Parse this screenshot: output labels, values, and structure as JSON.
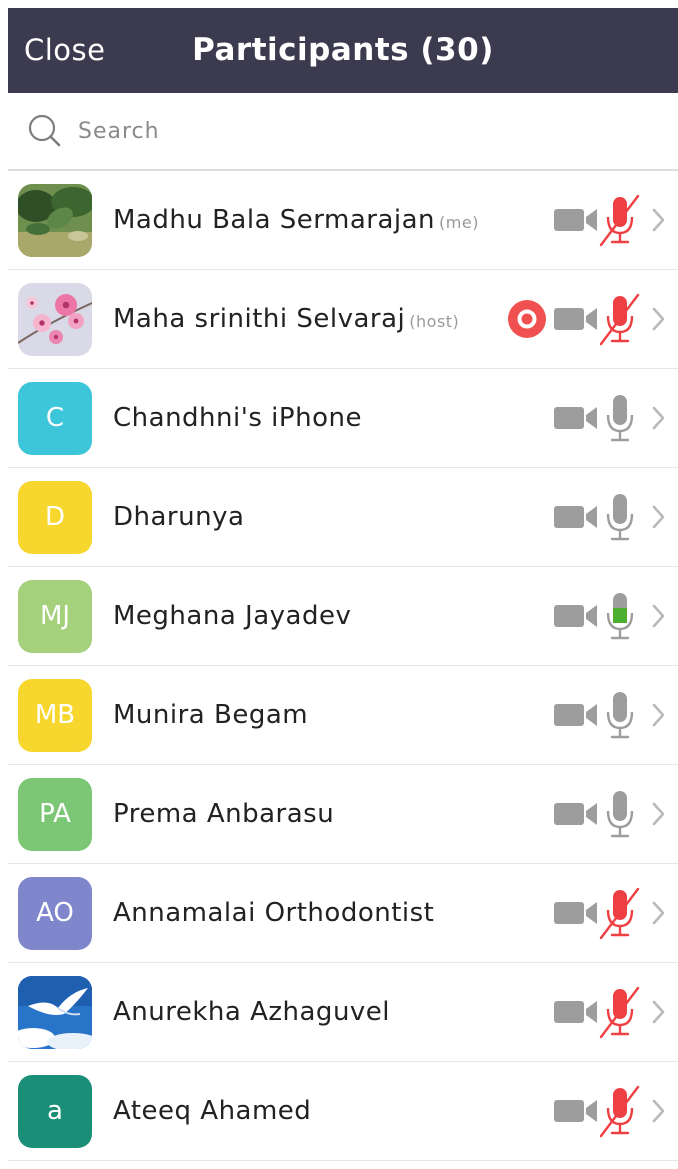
{
  "header": {
    "close_label": "Close",
    "title": "Participants (30)"
  },
  "search": {
    "placeholder": "Search",
    "icon": "search-icon"
  },
  "participants": [
    {
      "name": "Madhu Bala Sermarajan",
      "tag": "(me)",
      "avatar": "photo-leaves",
      "video": "off",
      "mic": "muted",
      "recording": false
    },
    {
      "name": "Maha srinithi Selvaraj",
      "tag": "(host)",
      "avatar": "photo-flowers",
      "video": "off",
      "mic": "muted",
      "recording": true
    },
    {
      "name": "Chandhni's iPhone",
      "tag": "",
      "avatar_initials": "C",
      "avatar_color": "#3dc6d9",
      "video": "off",
      "mic": "unmuted"
    },
    {
      "name": "Dharunya",
      "tag": "",
      "avatar_initials": "D",
      "avatar_color": "#f7d62e",
      "video": "off",
      "mic": "unmuted"
    },
    {
      "name": "Meghana Jayadev",
      "tag": "",
      "avatar_initials": "MJ",
      "avatar_color": "#a5d07c",
      "video": "off",
      "mic": "speaking"
    },
    {
      "name": "Munira Begam",
      "tag": "",
      "avatar_initials": "MB",
      "avatar_color": "#f7d62e",
      "video": "off",
      "mic": "unmuted"
    },
    {
      "name": "Prema Anbarasu",
      "tag": "",
      "avatar_initials": "PA",
      "avatar_color": "#7cc775",
      "video": "off",
      "mic": "unmuted"
    },
    {
      "name": "Annamalai Orthodontist",
      "tag": "",
      "avatar_initials": "AO",
      "avatar_color": "#7f86cc",
      "video": "off",
      "mic": "muted"
    },
    {
      "name": "Anurekha Azhaguvel",
      "tag": "",
      "avatar": "photo-dove-sky",
      "video": "off",
      "mic": "muted"
    },
    {
      "name": "Ateeq Ahamed",
      "tag": "",
      "avatar_initials": "a",
      "avatar_color": "#1b8e78",
      "video": "off",
      "mic": "muted"
    }
  ],
  "colors": {
    "header_bg": "#3b3a4e",
    "muted_red": "#ee4043",
    "speaking_green": "#4caf2f",
    "icon_gray": "#9d9d9d",
    "record_red": "#f0504f"
  }
}
